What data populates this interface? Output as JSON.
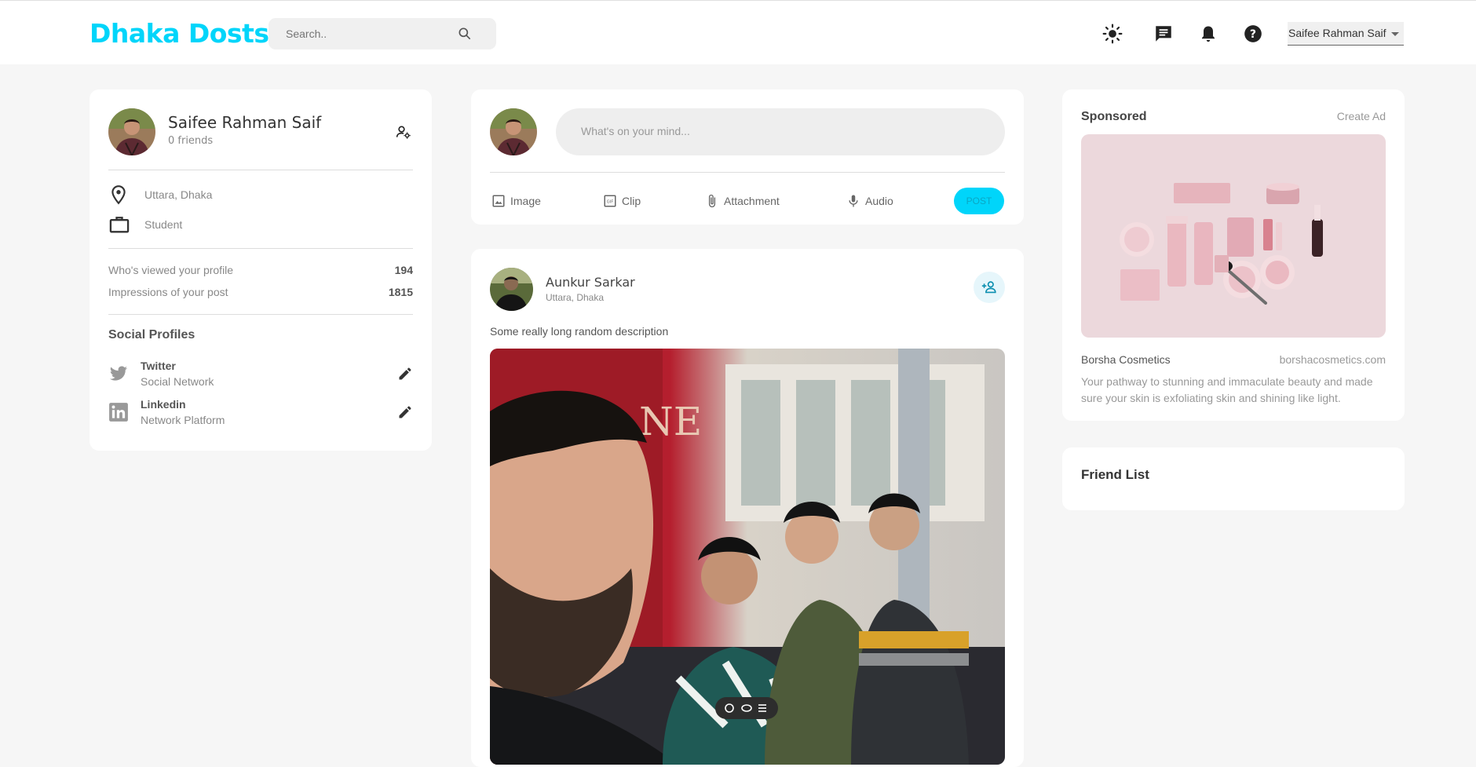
{
  "header": {
    "logo": "Dhaka Dosts",
    "search_placeholder": "Search..",
    "user_name": "Saifee Rahman Saif"
  },
  "profile": {
    "name": "Saifee Rahman Saif",
    "friends": "0 friends",
    "location": "Uttara, Dhaka",
    "occupation": "Student",
    "stats": [
      {
        "label": "Who's viewed your profile",
        "value": "194"
      },
      {
        "label": "Impressions of your post",
        "value": "1815"
      }
    ],
    "social_title": "Social Profiles",
    "social": [
      {
        "name": "Twitter",
        "sub": "Social Network"
      },
      {
        "name": "Linkedin",
        "sub": "Network Platform"
      }
    ]
  },
  "composer": {
    "placeholder": "What's on your mind...",
    "actions": [
      "Image",
      "Clip",
      "Attachment",
      "Audio"
    ],
    "post_label": "POST"
  },
  "post": {
    "author": "Aunkur Sarkar",
    "location": "Uttara, Dhaka",
    "description": "Some really long random description"
  },
  "sponsored": {
    "title": "Sponsored",
    "create_ad": "Create Ad",
    "brand": "Borsha Cosmetics",
    "url": "borshacosmetics.com",
    "text": "Your pathway to stunning and immaculate beauty and made sure your skin is exfoliating skin and shining like light."
  },
  "friend_list": {
    "title": "Friend List"
  },
  "colors": {
    "accent": "#00d5fa",
    "background": "#f6f6f6"
  }
}
